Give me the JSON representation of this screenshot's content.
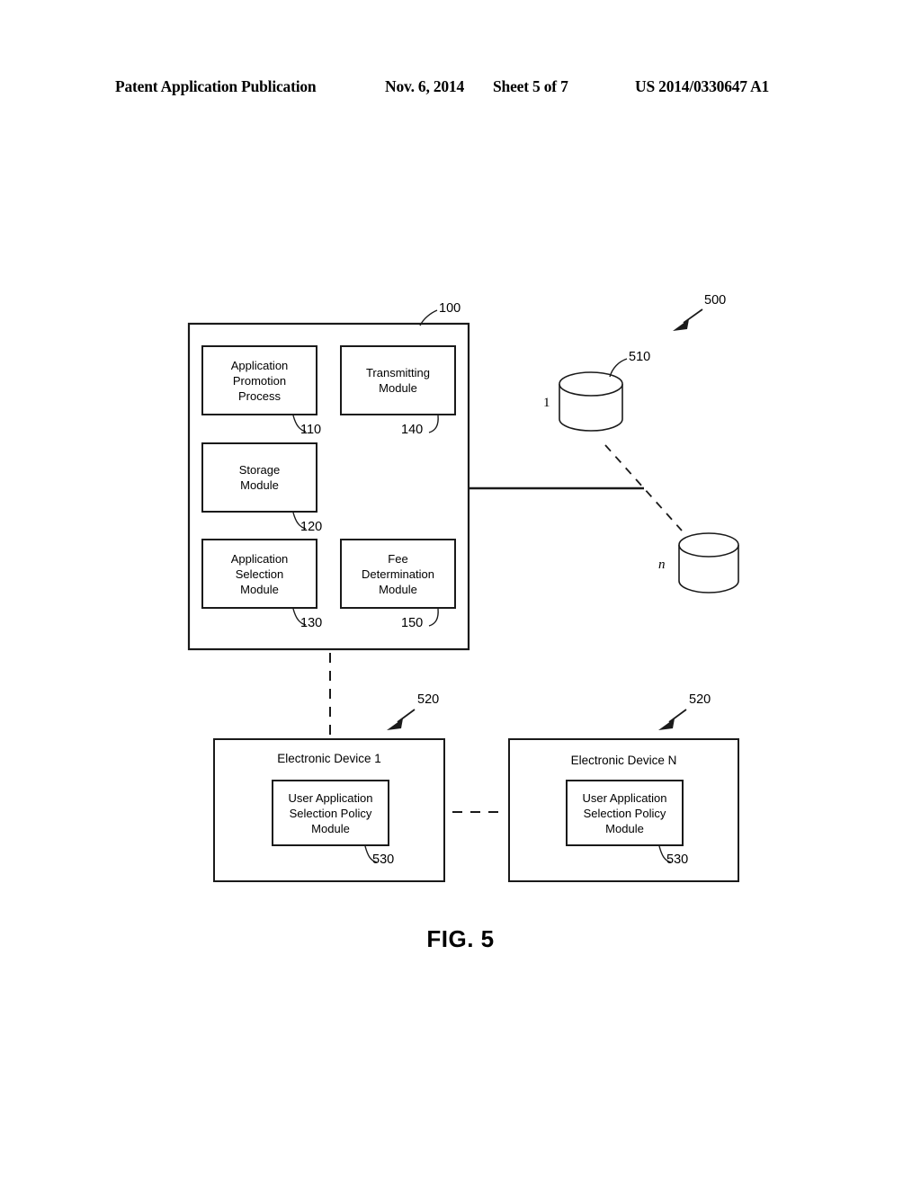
{
  "header": {
    "publication": "Patent Application Publication",
    "date": "Nov. 6, 2014",
    "sheet": "Sheet 5 of 7",
    "patent_number": "US 2014/0330647 A1"
  },
  "figure": {
    "caption": "FIG. 5",
    "overall_ref": "500",
    "server": {
      "ref": "100",
      "modules": [
        {
          "label": "Application\nPromotion\nProcess",
          "ref": "110"
        },
        {
          "label": "Transmitting\nModule",
          "ref": "140"
        },
        {
          "label": "Storage\nModule",
          "ref": "120"
        },
        {
          "label": "Application\nSelection\nModule",
          "ref": "130"
        },
        {
          "label": "Fee\nDetermination\nModule",
          "ref": "150"
        }
      ]
    },
    "databases": {
      "ref": "510",
      "first_label": "1",
      "last_label": "n"
    },
    "devices": [
      {
        "title": "Electronic Device 1",
        "ref": "520",
        "module_label": "User Application\nSelection Policy\nModule",
        "module_ref": "530"
      },
      {
        "title": "Electronic Device N",
        "ref": "520",
        "module_label": "User Application\nSelection Policy\nModule",
        "module_ref": "530"
      }
    ]
  },
  "colors": {
    "ink": "#1a1a1a",
    "paper": "#ffffff"
  }
}
